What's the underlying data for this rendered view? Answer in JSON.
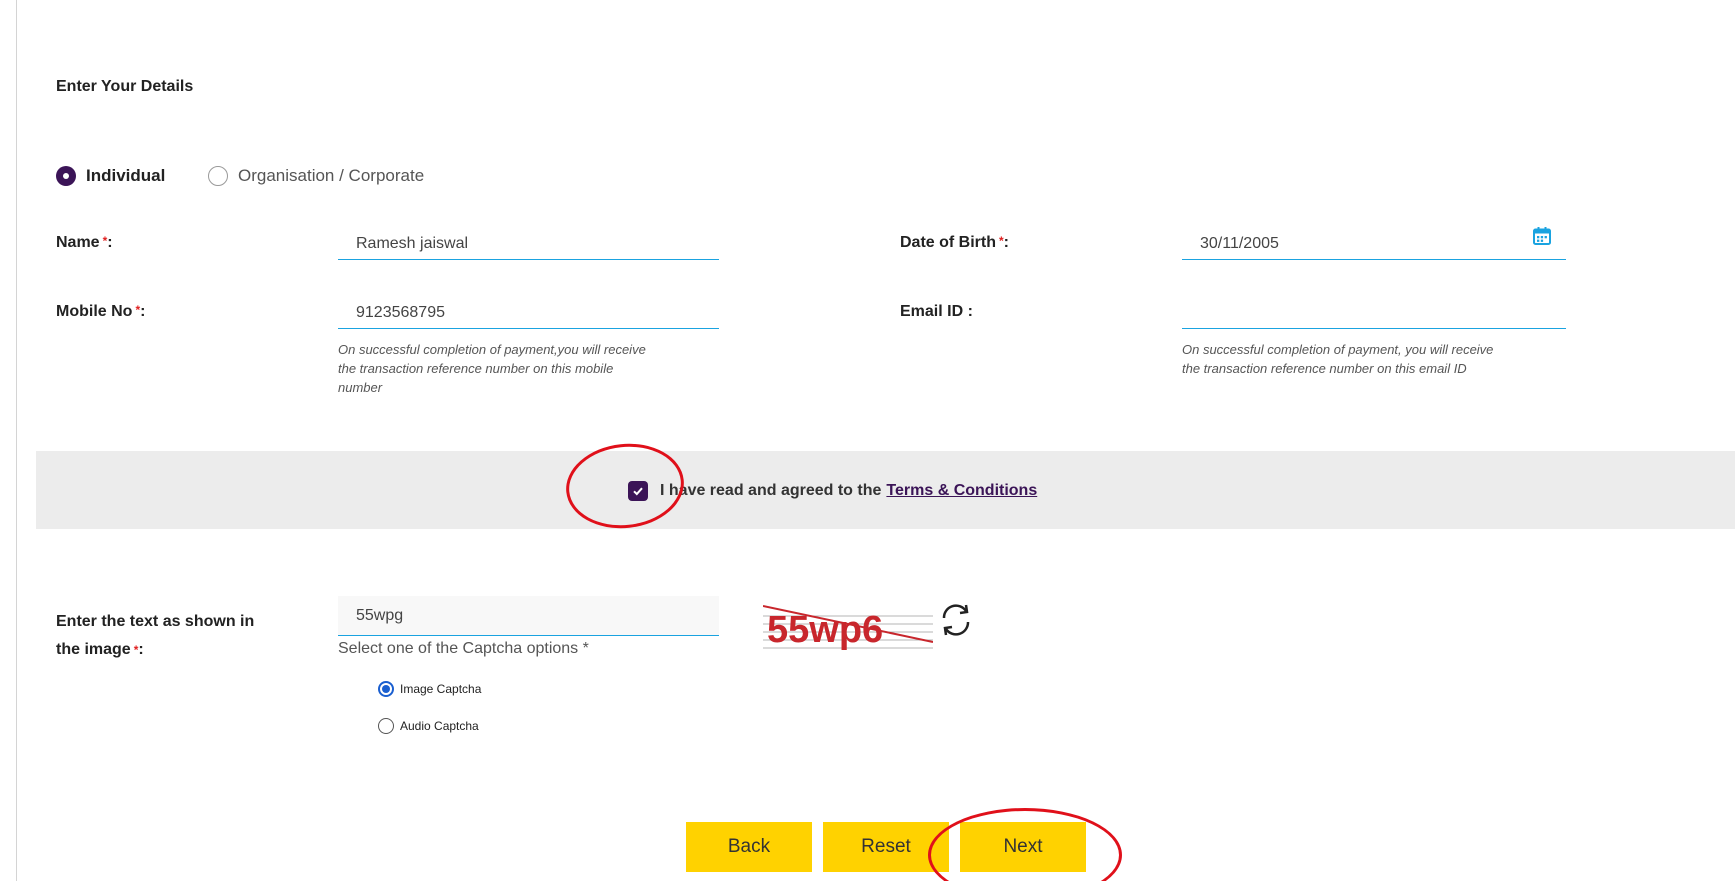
{
  "form": {
    "title": "Enter Your Details",
    "applicant_type": {
      "individual_label": "Individual",
      "corporate_label": "Organisation / Corporate",
      "selected": "Individual"
    },
    "name": {
      "label": "Name",
      "required_mark": "*",
      "suffix": ":",
      "value": "Ramesh jaiswal"
    },
    "dob": {
      "label": "Date of Birth",
      "required_mark": "*",
      "suffix": ":",
      "value": "30/11/2005",
      "icon": "calendar-icon"
    },
    "mobile": {
      "label": "Mobile No",
      "required_mark": "*",
      "suffix": ":",
      "value": "9123568795",
      "hint_lines": [
        "On successful completion of payment,you will receive",
        "the transaction reference number on this mobile",
        "number"
      ]
    },
    "email": {
      "label": "Email ID :",
      "value": "",
      "hint_lines": [
        "On successful completion of payment, you will receive",
        "the transaction reference number on this email ID"
      ]
    }
  },
  "terms": {
    "checked": true,
    "text": "I have read and agreed to the",
    "link_text": "Terms & Conditions"
  },
  "captcha": {
    "label_line1": "Enter the text as shown in",
    "label_line2": "the image",
    "required_mark": "*",
    "suffix": ":",
    "value": "55wpg",
    "image_text": "55wp6",
    "options_prompt": "Select one of the Captcha options *",
    "options": [
      {
        "label": "Image Captcha",
        "selected": true
      },
      {
        "label": "Audio Captcha",
        "selected": false
      }
    ]
  },
  "buttons": {
    "back": "Back",
    "reset": "Reset",
    "next": "Next"
  },
  "colors": {
    "accent_purple": "#3b1457",
    "field_underline": "#1aa3e0",
    "button_yellow": "#ffd200",
    "annotation_red": "#e0101a",
    "captcha_red": "#c8262c"
  }
}
